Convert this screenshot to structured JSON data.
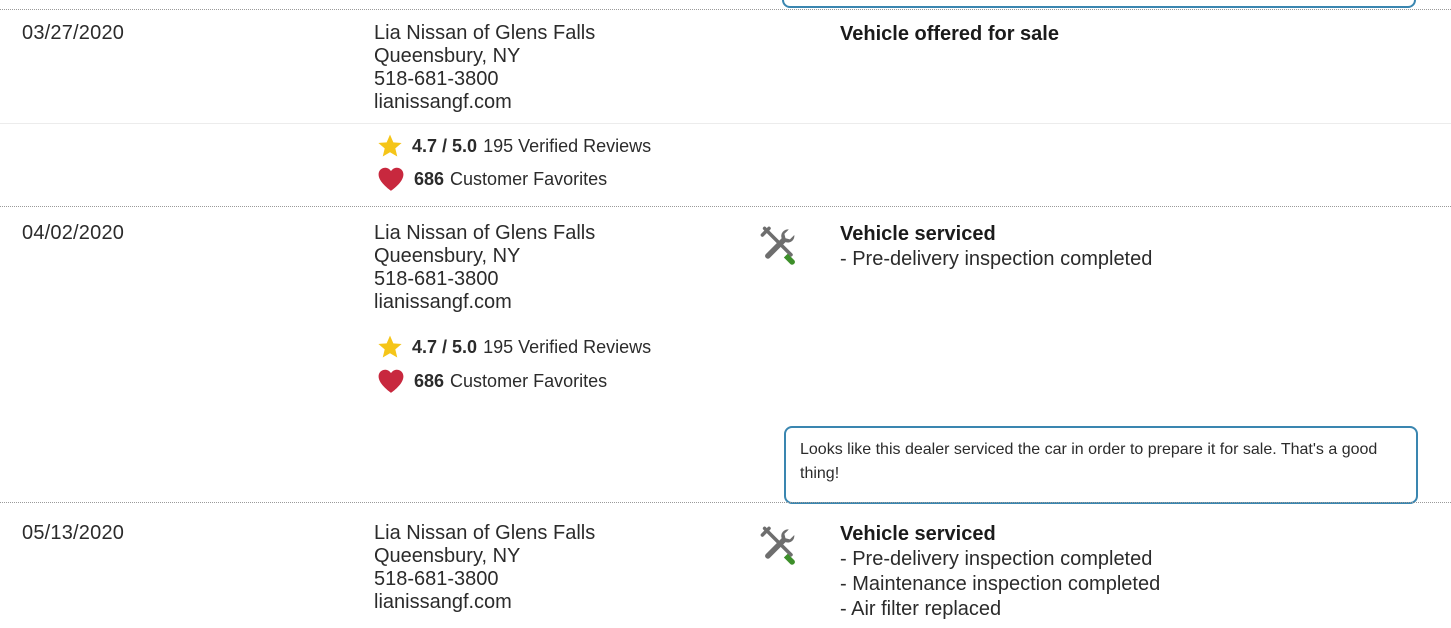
{
  "records": [
    {
      "date": "03/27/2020",
      "dealer": {
        "name": "Lia Nissan of Glens Falls",
        "location": "Queensbury, NY",
        "phone": "518-681-3800",
        "website": "lianissangf.com"
      },
      "rating": {
        "score": "4.7 / 5.0",
        "reviews": "195 Verified Reviews"
      },
      "favorites": {
        "count": "686",
        "label": "Customer Favorites"
      },
      "event": {
        "title": "Vehicle offered for sale",
        "details": []
      }
    },
    {
      "date": "04/02/2020",
      "dealer": {
        "name": "Lia Nissan of Glens Falls",
        "location": "Queensbury, NY",
        "phone": "518-681-3800",
        "website": "lianissangf.com"
      },
      "rating": {
        "score": "4.7 / 5.0",
        "reviews": "195 Verified Reviews"
      },
      "favorites": {
        "count": "686",
        "label": "Customer Favorites"
      },
      "event": {
        "icon": "wrench-screwdriver-icon",
        "title": "Vehicle serviced",
        "details": [
          "- Pre-delivery inspection completed"
        ]
      },
      "note": "Looks like this dealer serviced the car in order to prepare it for sale. That's a good thing!"
    },
    {
      "date": "05/13/2020",
      "dealer": {
        "name": "Lia Nissan of Glens Falls",
        "location": "Queensbury, NY",
        "phone": "518-681-3800",
        "website": "lianissangf.com"
      },
      "event": {
        "icon": "wrench-screwdriver-icon",
        "title": "Vehicle serviced",
        "details": [
          "- Pre-delivery inspection completed",
          "- Maintenance inspection completed",
          "- Air filter replaced"
        ]
      }
    }
  ],
  "colors": {
    "star": "#f5c518",
    "heart": "#c8283e",
    "note_border": "#3a86b0",
    "screwdriver_handle": "#3d8f2a"
  }
}
